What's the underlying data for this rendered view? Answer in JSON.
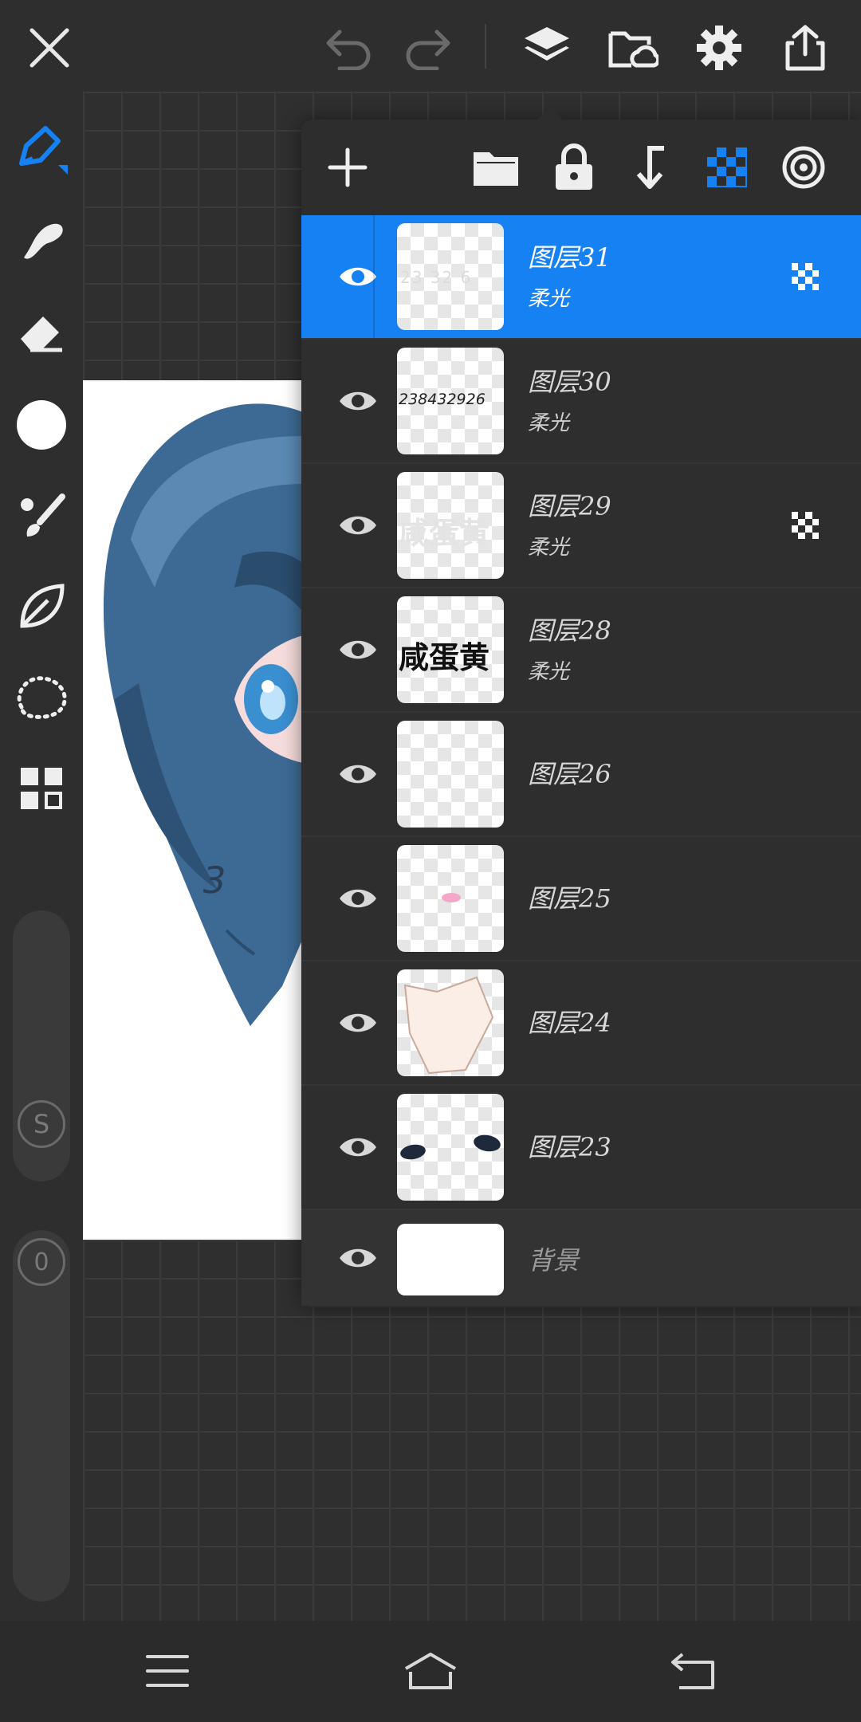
{
  "app": {
    "accent_color": "#1681f2"
  },
  "topbar": {
    "icons": [
      "close-icon",
      "undo-icon",
      "redo-icon",
      "layers-icon",
      "cloud-folder-icon",
      "gear-icon",
      "share-icon"
    ]
  },
  "left_tools": {
    "icons": [
      "pen-icon",
      "smudge-icon",
      "eraser-icon",
      "color-swatch",
      "brush-library-icon",
      "leaf-icon",
      "lasso-icon",
      "grid-icon"
    ],
    "current_color": "#ffffff",
    "size_badge": "S",
    "opacity_badge": "0"
  },
  "layers_panel": {
    "toolbar_icons": [
      "add-layer-icon",
      "folder-icon",
      "lock-icon",
      "merge-down-icon",
      "alpha-lock-icon",
      "target-icon"
    ],
    "layers": [
      {
        "name": "图层31",
        "mode": "柔光",
        "thumb_text": "23 32 6",
        "alpha_lock": true,
        "selected": true
      },
      {
        "name": "图层30",
        "mode": "柔光",
        "thumb_text": "238432926",
        "alpha_lock": false,
        "selected": false
      },
      {
        "name": "图层29",
        "mode": "柔光",
        "thumb_text": "咸蛋黄",
        "alpha_lock": true,
        "selected": false
      },
      {
        "name": "图层28",
        "mode": "柔光",
        "thumb_text": "咸蛋黄",
        "alpha_lock": false,
        "selected": false
      },
      {
        "name": "图层26",
        "mode": "",
        "thumb_text": "",
        "alpha_lock": false,
        "selected": false
      },
      {
        "name": "图层25",
        "mode": "",
        "thumb_text": "",
        "alpha_lock": false,
        "selected": false
      },
      {
        "name": "图层24",
        "mode": "",
        "thumb_text": "",
        "alpha_lock": false,
        "selected": false
      },
      {
        "name": "图层23",
        "mode": "",
        "thumb_text": "",
        "alpha_lock": false,
        "selected": false
      }
    ],
    "background": {
      "name": "背景"
    }
  },
  "artboard": {
    "watermark_text": "3"
  },
  "bottom_nav": {
    "icons": [
      "menu-icon",
      "home-icon",
      "back-icon"
    ]
  }
}
